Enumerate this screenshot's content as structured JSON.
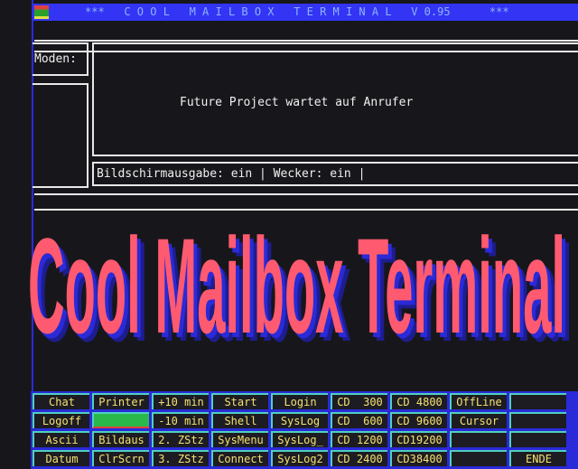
{
  "header": {
    "title": "***   C O O L   M A I L B O X   T E R M I N A L   V 0.95      ***"
  },
  "modem_label": "Moden:",
  "message": "Future Project wartet auf Anrufer",
  "status_line": "Bildschirmausgabe: ein | Wecker: ein |",
  "banner": "Cool Mailbox Terminal",
  "buttons": [
    [
      "Chat",
      "Printer",
      "+10 min",
      "Start",
      "Login",
      "CD  300",
      "CD 4800",
      "OffLine",
      ""
    ],
    [
      "Logoff",
      "",
      "-10 min",
      "Shell",
      "SysLog",
      "CD  600",
      "CD 9600",
      "Cursor",
      ""
    ],
    [
      "Ascii",
      "Bildaus",
      "2. ZStz",
      "SysMenu",
      "SysLog_",
      "CD 1200",
      "CD19200",
      "",
      ""
    ],
    [
      "Datum",
      "ClrScrn",
      "3. ZStz",
      "Connect",
      "SysLog2",
      "CD 2400",
      "CD38400",
      "",
      "ENDE"
    ]
  ],
  "colors": {
    "titlebar": "#3434f4",
    "banner": "#ff5a70",
    "button_text": "#f6e070",
    "button_active": "#2bb84a"
  }
}
